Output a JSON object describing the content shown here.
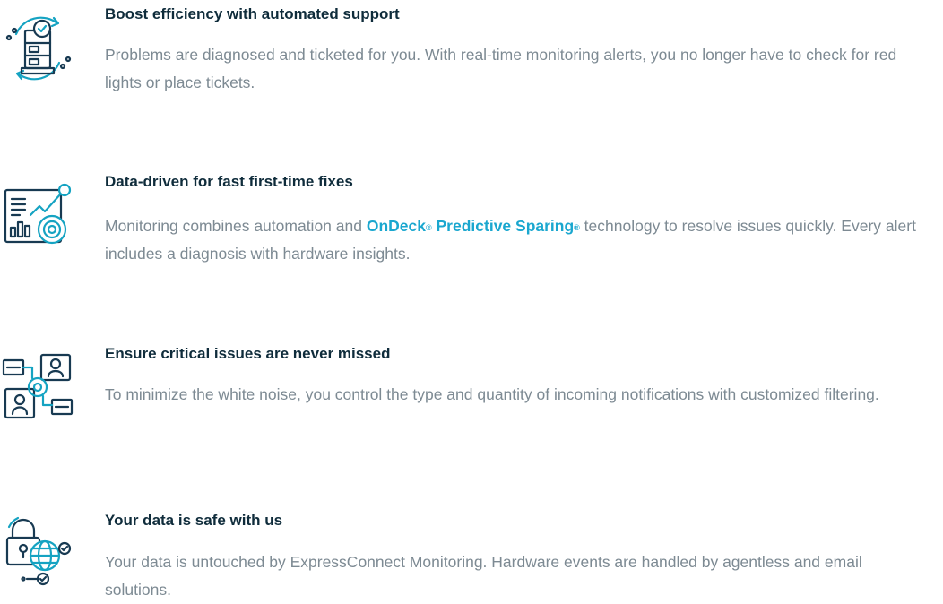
{
  "features": [
    {
      "title": "Boost efficiency with automated support",
      "description": "Problems are diagnosed and ticketed for you. With real-time monitoring alerts, you no longer have to check for red lights or place tickets.",
      "icon": "server-sync-icon"
    },
    {
      "title": "Data-driven for fast first-time fixes",
      "description_before": "Monitoring combines automation and ",
      "brand_1": "OnDeck",
      "reg_1": "®",
      "brand_space": " ",
      "brand_2": "Predictive Sparing",
      "reg_2": "®",
      "description_after": "  technology to resolve issues quickly. Every alert includes a diagnosis with hardware insights.",
      "icon": "analytics-dashboard-icon"
    },
    {
      "title": "Ensure critical issues are never missed",
      "description": "To minimize the white noise, you control the type and quantity of incoming notifications with customized filtering.",
      "icon": "user-network-settings-icon"
    },
    {
      "title": "Your data is safe with us",
      "description": "Your data is untouched by ExpressConnect Monitoring. Hardware events are handled by agentless and email solutions.",
      "icon": "secure-globe-lock-icon"
    }
  ],
  "colors": {
    "title": "#0f2c3b",
    "body": "#7d8a93",
    "brand": "#1aa7cf",
    "icon_navy": "#183a52",
    "icon_teal": "#15a3c2"
  }
}
